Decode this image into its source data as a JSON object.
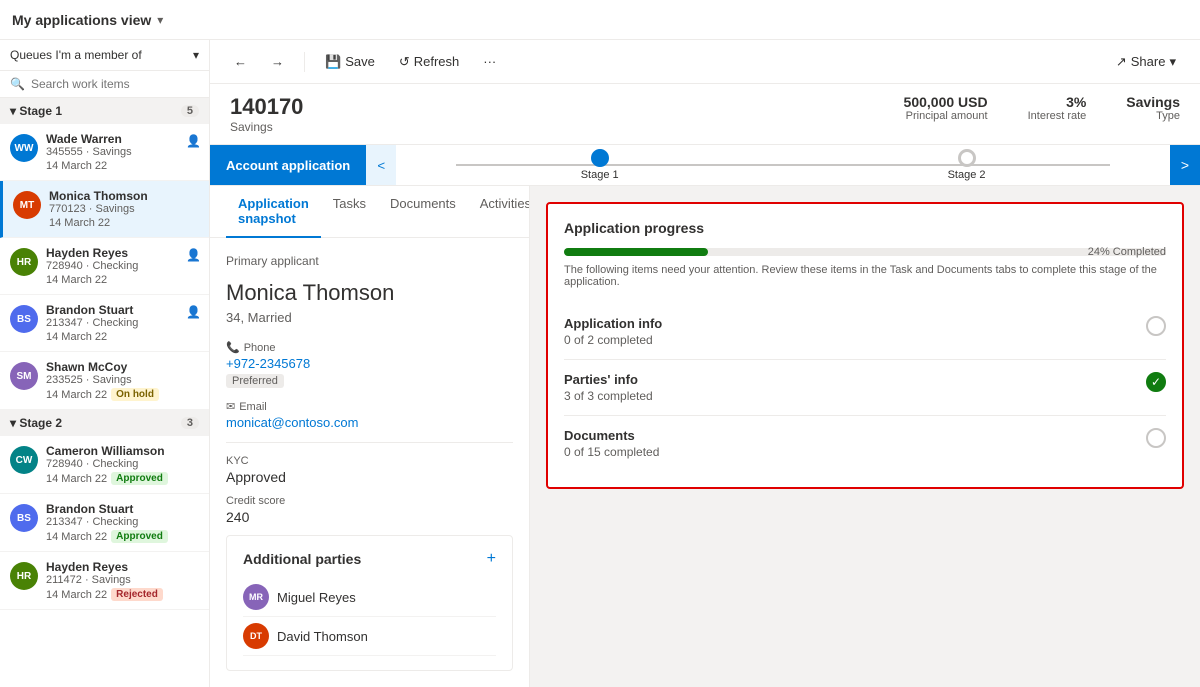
{
  "topBar": {
    "title": "My applications view",
    "chevron": "▾"
  },
  "sidebar": {
    "queueSelector": "Queues I'm a member of",
    "searchPlaceholder": "Search work items",
    "stage1": {
      "label": "Stage 1",
      "count": "5",
      "items": [
        {
          "id": "ww",
          "initials": "WW",
          "color": "#0078d4",
          "name": "Wade Warren",
          "number": "345555",
          "type": "Savings",
          "date": "14 March 22",
          "badge": null
        },
        {
          "id": "mt",
          "initials": "MT",
          "color": "#d83b01",
          "name": "Monica Thomson",
          "number": "770123",
          "type": "Savings",
          "date": "14 March 22",
          "badge": null,
          "active": true
        },
        {
          "id": "hr",
          "initials": "HR",
          "color": "#498205",
          "name": "Hayden Reyes",
          "number": "728940",
          "type": "Checking",
          "date": "14 March 22",
          "badge": null
        },
        {
          "id": "bs",
          "initials": "BS",
          "color": "#4f6bed",
          "name": "Brandon Stuart",
          "number": "213347",
          "type": "Checking",
          "date": "14 March 22",
          "badge": null
        },
        {
          "id": "sm",
          "initials": "SM",
          "color": "#8764b8",
          "name": "Shawn McCoy",
          "number": "233525",
          "type": "Savings",
          "date": "14 March 22",
          "badge": "onhold"
        }
      ]
    },
    "stage2": {
      "label": "Stage 2",
      "count": "3",
      "items": [
        {
          "id": "cw",
          "initials": "CW",
          "color": "#038387",
          "name": "Cameron Williamson",
          "number": "728940",
          "type": "Checking",
          "date": "14 March 22",
          "badge": "approved"
        },
        {
          "id": "bs2",
          "initials": "BS",
          "color": "#4f6bed",
          "name": "Brandon Stuart",
          "number": "213347",
          "type": "Checking",
          "date": "14 March 22",
          "badge": "approved"
        },
        {
          "id": "hr2",
          "initials": "HR",
          "color": "#498205",
          "name": "Hayden Reyes",
          "number": "211472",
          "type": "Savings",
          "date": "14 March 22",
          "badge": "rejected"
        }
      ]
    }
  },
  "toolbar": {
    "back_label": "←",
    "forward_label": "→",
    "save_label": "Save",
    "refresh_label": "Refresh",
    "more_label": "···",
    "share_label": "Share"
  },
  "record": {
    "id": "140170",
    "type": "Savings",
    "principalAmount": "500,000 USD",
    "principalLabel": "Principal amount",
    "interestRate": "3%",
    "interestLabel": "Interest rate",
    "savingsType": "Savings",
    "savingsLabel": "Type"
  },
  "processBar": {
    "activeStep": "Account application",
    "stages": [
      {
        "label": "Stage 1",
        "status": "active"
      },
      {
        "label": "Stage 2",
        "status": "pending"
      }
    ]
  },
  "tabs": [
    "Application snapshot",
    "Tasks",
    "Documents",
    "Activities"
  ],
  "primaryApplicant": {
    "sectionLabel": "Primary applicant",
    "name": "Monica Thomson",
    "details": "34, Married",
    "phoneLabel": "Phone",
    "phone": "+972-2345678",
    "phoneTag": "Preferred",
    "emailLabel": "Email",
    "email": "monicat@contoso.com",
    "kycLabel": "KYC",
    "kycValue": "Approved",
    "creditScoreLabel": "Credit score",
    "creditScoreValue": "240"
  },
  "additionalParties": {
    "title": "Additional parties",
    "parties": [
      {
        "initials": "MR",
        "color": "#8764b8",
        "name": "Miguel Reyes"
      },
      {
        "initials": "DT",
        "color": "#d83b01",
        "name": "David Thomson"
      }
    ]
  },
  "applicationProgress": {
    "title": "Application progress",
    "percentage": 24,
    "percentageLabel": "24% Completed",
    "note": "The following items need your attention. Review these items in the Task and Documents tabs to complete this stage of the application.",
    "items": [
      {
        "name": "Application info",
        "sub": "0 of 2 completed",
        "status": "incomplete"
      },
      {
        "name": "Parties' info",
        "sub": "3 of 3 completed",
        "status": "complete"
      },
      {
        "name": "Documents",
        "sub": "0 of 15 completed",
        "status": "incomplete"
      }
    ]
  },
  "icons": {
    "chevronDown": "▾",
    "search": "🔍",
    "save": "💾",
    "refresh": "↺",
    "share": "↗",
    "phone": "📞",
    "email": "✉",
    "plus": "+",
    "check": "✓",
    "back": "←",
    "forward": "→",
    "leftArrow": "<",
    "rightArrow": ">"
  }
}
